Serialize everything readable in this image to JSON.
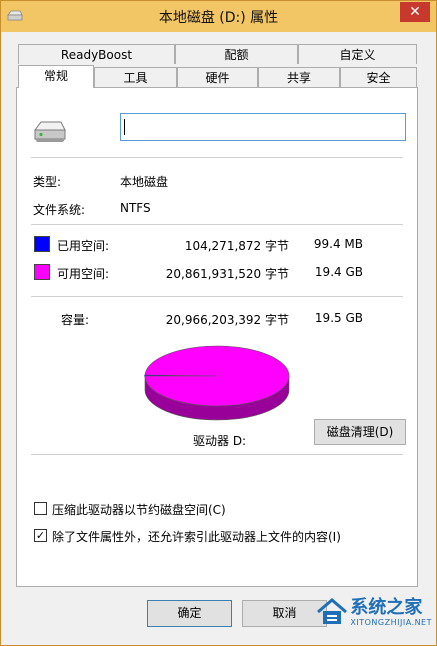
{
  "window": {
    "title": "本地磁盘 (D:) 属性",
    "close_glyph": "✕"
  },
  "tabs_row1": [
    "ReadyBoost",
    "配额",
    "自定义"
  ],
  "tabs_row2": [
    "常规",
    "工具",
    "硬件",
    "共享",
    "安全"
  ],
  "general": {
    "name_value": "",
    "type_label": "类型:",
    "type_value": "本地磁盘",
    "fs_label": "文件系统:",
    "fs_value": "NTFS",
    "used": {
      "label": "已用空间:",
      "bytes": "104,271,872 字节",
      "size": "99.4 MB",
      "color": "#0000ff"
    },
    "free": {
      "label": "可用空间:",
      "bytes": "20,861,931,520 字节",
      "size": "19.4 GB",
      "color": "#ff00ff"
    },
    "capacity": {
      "label": "容量:",
      "bytes": "20,966,203,392 字节",
      "size": "19.5 GB"
    },
    "drive_label": "驱动器 D:",
    "cleanup_button": "磁盘清理(D)",
    "compress_checkbox": {
      "label": "压缩此驱动器以节约磁盘空间(C)",
      "checked": false
    },
    "index_checkbox": {
      "label": "除了文件属性外，还允许索引此驱动器上文件的内容(I)",
      "checked": true
    }
  },
  "chart_data": {
    "type": "pie",
    "slices": [
      {
        "name": "已用空间",
        "value": 104271872,
        "color": "#0000ff"
      },
      {
        "name": "可用空间",
        "value": 20861931520,
        "color": "#ff00ff"
      }
    ]
  },
  "footer": {
    "ok_button": "确定",
    "cancel_button": "取消"
  },
  "watermark": {
    "brand": "系统之家",
    "url": "XITONGZHIJIA.NET"
  }
}
